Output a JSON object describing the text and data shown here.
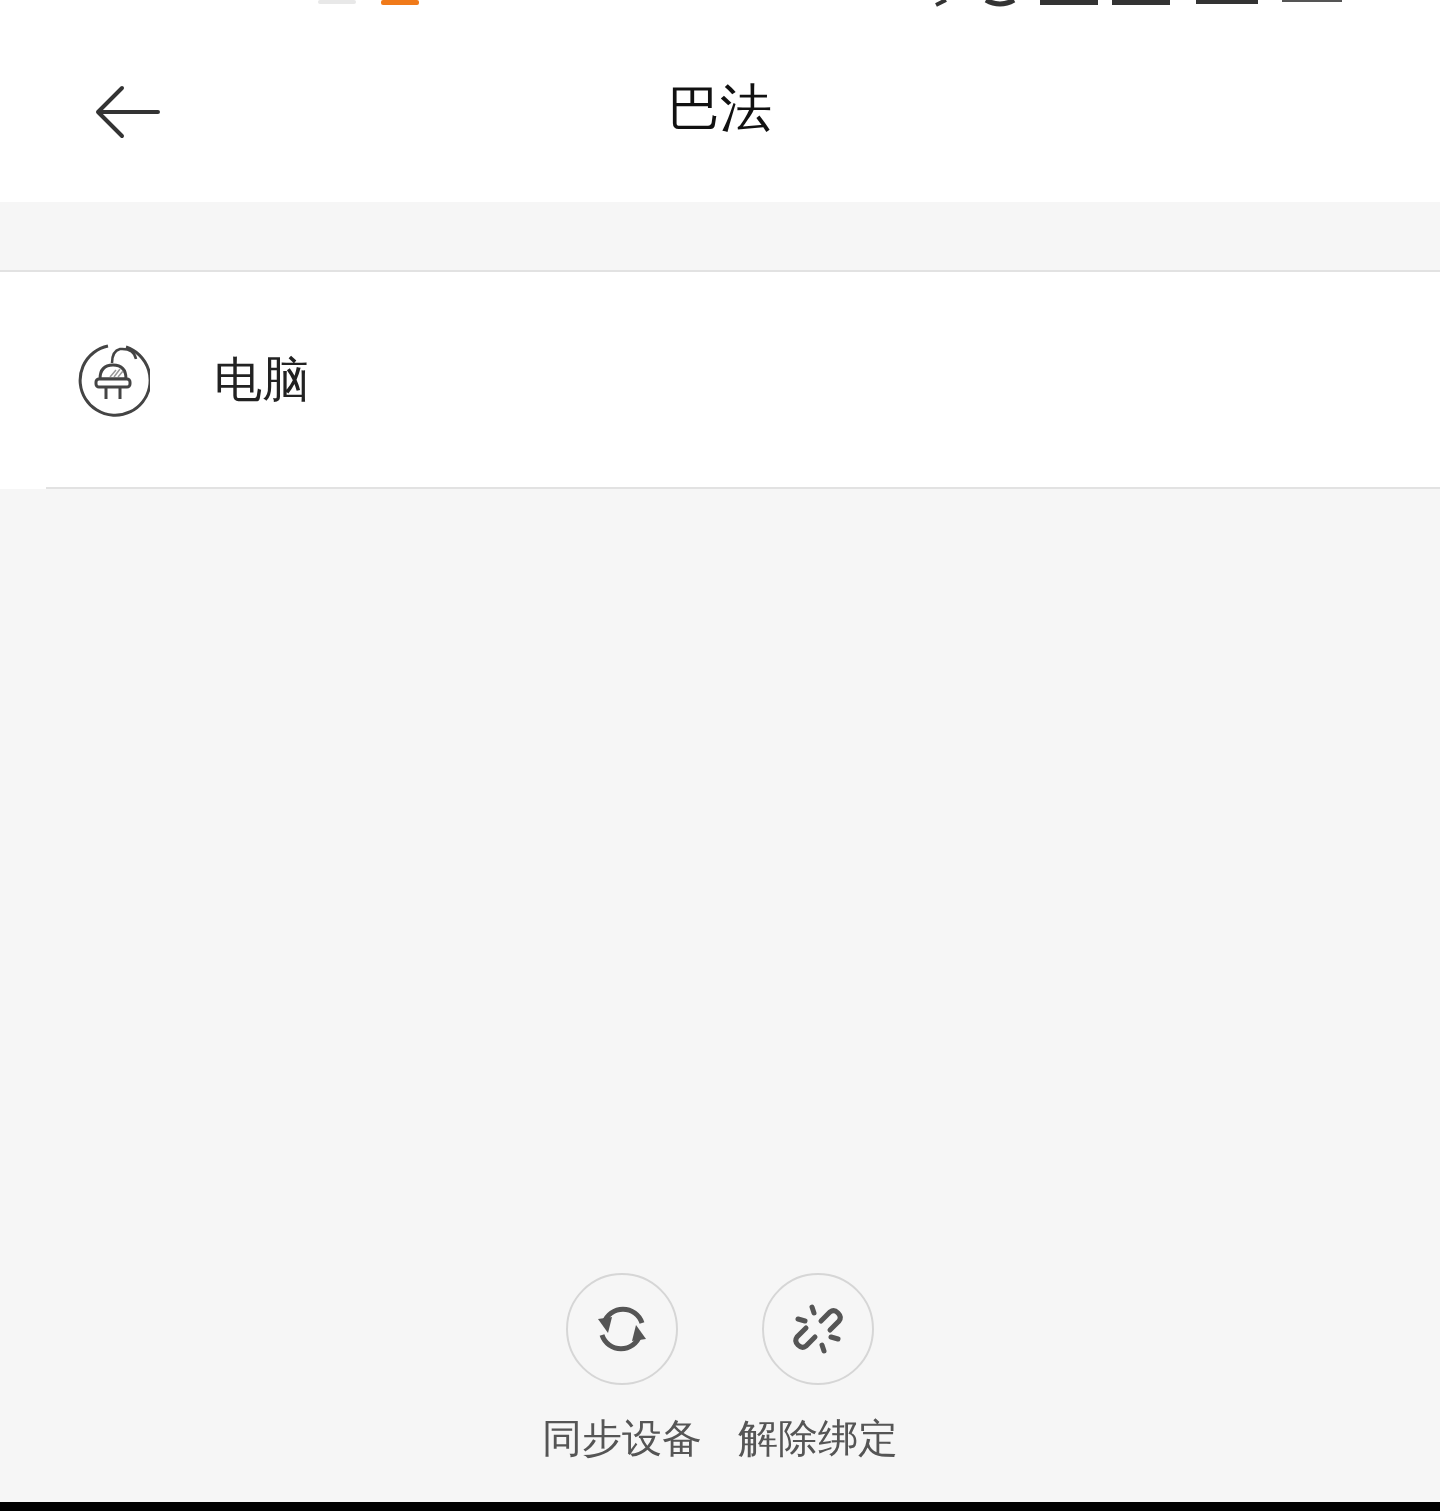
{
  "header": {
    "title": "巴法"
  },
  "devices": [
    {
      "name": "电脑",
      "kind": "plug"
    }
  ],
  "actions": [
    {
      "label": "同步设备",
      "kind": "sync"
    },
    {
      "label": "解除绑定",
      "kind": "unbind"
    }
  ]
}
